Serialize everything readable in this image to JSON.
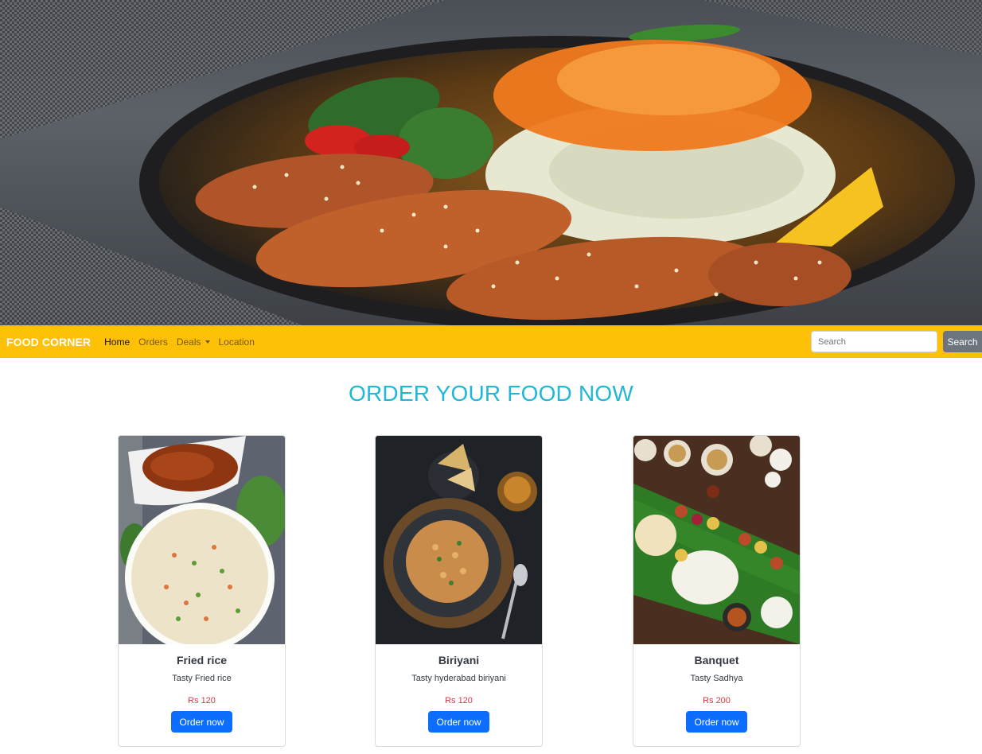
{
  "navbar": {
    "brand": "FOOD CORNER",
    "links": [
      "Home",
      "Orders",
      "Deals",
      "Location"
    ],
    "active_link": "Home",
    "search_placeholder": "Search",
    "search_button": "Search",
    "color": "#ffc107"
  },
  "main": {
    "heading": "ORDER YOUR FOOD NOW",
    "cards": [
      {
        "title": "Fried rice",
        "text": "Tasty Fried rice",
        "price": "Rs 120",
        "button": "Order now"
      },
      {
        "title": "Biriyani",
        "text": "Tasty hyderabad biriyani",
        "price": "Rs 120",
        "button": "Order now"
      },
      {
        "title": "Banquet",
        "text": "Tasty Sadhya",
        "price": "Rs 200",
        "button": "Order now"
      }
    ]
  },
  "colors": {
    "heading": "#1fb8d8",
    "price": "#dc3545",
    "primary_button": "#0d6efd",
    "secondary_button": "#6c757d"
  }
}
